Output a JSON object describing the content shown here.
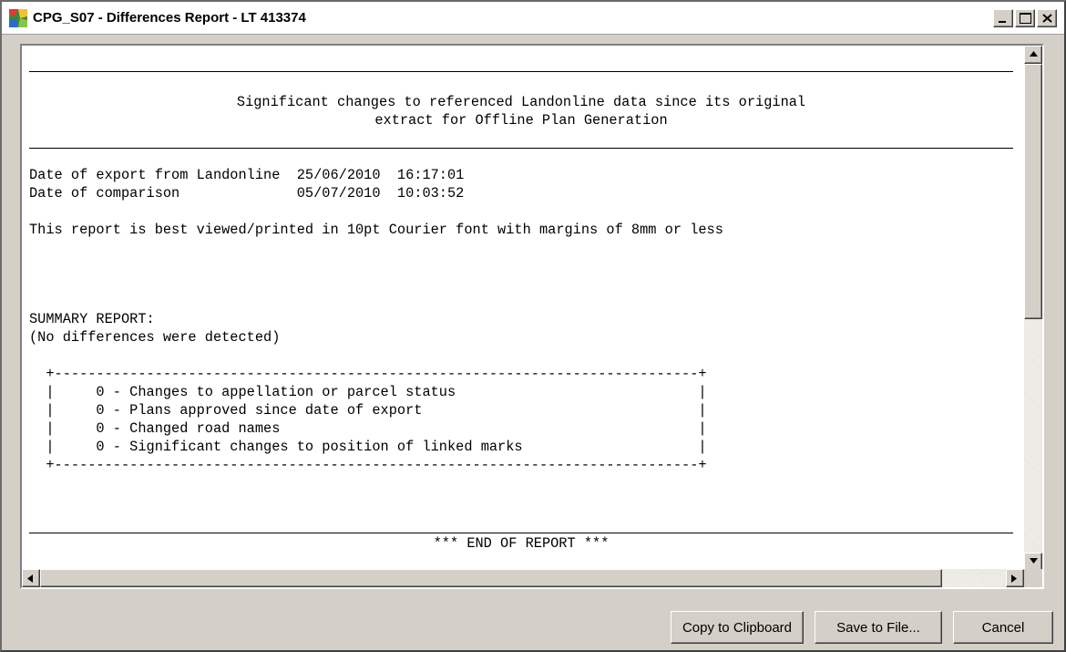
{
  "window": {
    "title": "CPG_S07 - Differences Report - LT 413374",
    "app_icon": "landonline-app-icon",
    "title_buttons": [
      "minimize-icon",
      "maximize-icon",
      "close-icon"
    ]
  },
  "report": {
    "heading_line1": "Significant changes to referenced Landonline data since its original",
    "heading_line2": "extract for Offline Plan Generation",
    "export_line": "Date of export from Landonline  25/06/2010  16:17:01",
    "comparison_line": "Date of comparison              05/07/2010  10:03:52",
    "viewing_note": "This report is best viewed/printed in 10pt Courier font with margins of 8mm or less",
    "summary_label": "SUMMARY REPORT:",
    "summary_status": "(No differences were detected)",
    "box_border": "  +-----------------------------------------------------------------------------+",
    "summary_rows": [
      "  |     0 - Changes to appellation or parcel status                             |",
      "  |     0 - Plans approved since date of export                                 |",
      "  |     0 - Changed road names                                                  |",
      "  |     0 - Significant changes to position of linked marks                     |"
    ],
    "end_marker": "*** END OF REPORT ***"
  },
  "buttons": {
    "copy": "Copy to Clipboard",
    "save": "Save to File...",
    "cancel": "Cancel"
  }
}
